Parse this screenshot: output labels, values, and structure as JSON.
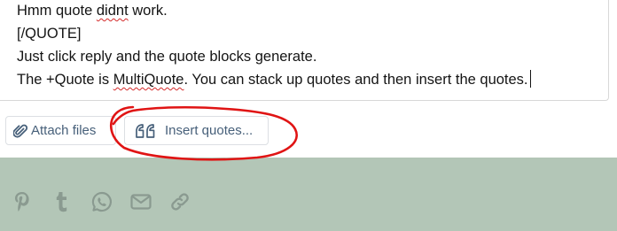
{
  "editor": {
    "lines": {
      "l1_before": "Hmm quote ",
      "l1_misspelled": "didnt",
      "l1_after": " work.",
      "l2": "[/QUOTE]",
      "l3": "Just click reply and the quote blocks generate.",
      "l4_before": "The +Quote is ",
      "l4_misspelled": "MultiQuote",
      "l4_after": ". You can stack up quotes and then insert the quotes."
    }
  },
  "toolbar": {
    "attach_label": "Attach files",
    "insert_quotes_label": "Insert quotes..."
  },
  "share": {
    "icons": [
      "pinterest-icon",
      "tumblr-icon",
      "whatsapp-icon",
      "email-icon",
      "link-icon"
    ]
  },
  "colors": {
    "button_text": "#47607a",
    "footer_bg": "#b3c6b7",
    "share_icon": "#8a9a90",
    "annotation": "#e01414"
  }
}
